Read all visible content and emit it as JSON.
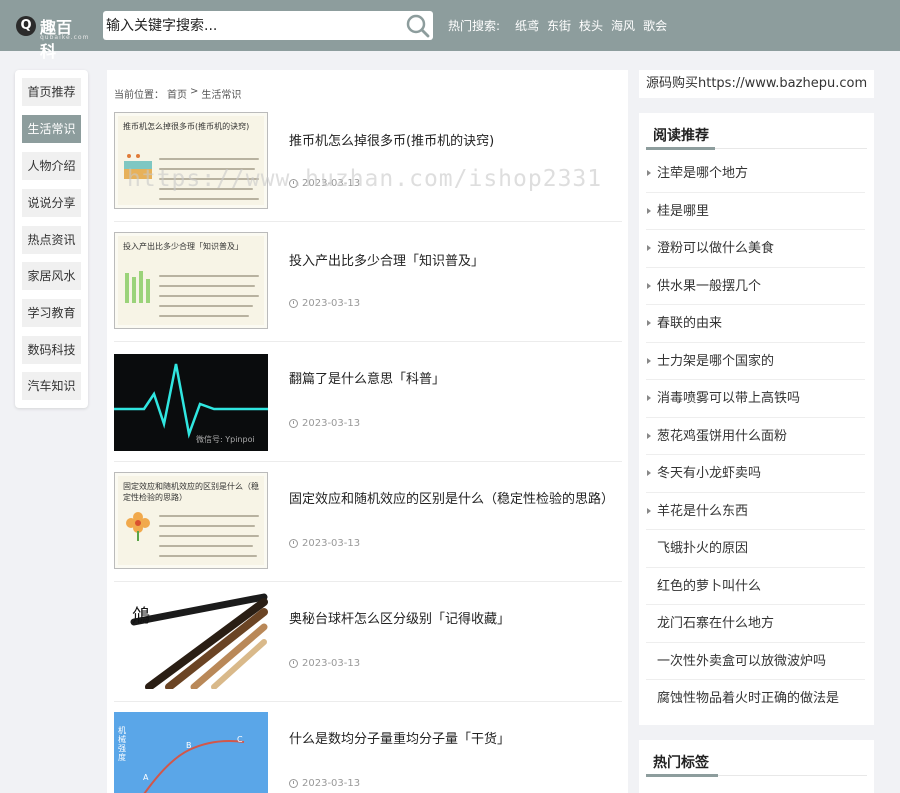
{
  "site": {
    "logo_text": "趣百科",
    "logo_sub": "qubaike.com"
  },
  "search": {
    "placeholder": "输入关键字搜索..."
  },
  "hot_search": {
    "label": "热门搜索:",
    "items": [
      "纸鸢",
      "东街",
      "枝头",
      "海风",
      "歌会"
    ]
  },
  "nav": {
    "items": [
      "首页推荐",
      "生活常识",
      "人物介绍",
      "说说分享",
      "热点资讯",
      "家居风水",
      "学习教育",
      "数码科技",
      "汽车知识"
    ],
    "active_index": 1
  },
  "breadcrumb": {
    "label": "当前位置：",
    "home": "首页",
    "sep": ">",
    "current": "生活常识"
  },
  "watermark": "https://www.huzhan.com/ishop2331",
  "articles": [
    {
      "title": "推币机怎么掉很多币(推币机的诀窍)",
      "date": "2023-03-13",
      "thumb_caption": "推币机怎么掉很多币(推币机的诀窍)",
      "thumb_icon": "coin-machine-icon"
    },
    {
      "title": "投入产出比多少合理「知识普及」",
      "date": "2023-03-13",
      "thumb_caption": "投入产出比多少合理「知识普及」",
      "thumb_icon": "bars-icon"
    },
    {
      "title": "翻篇了是什么意思「科普」",
      "date": "2023-03-13",
      "thumb_caption": "微信号: Ypinpoi",
      "thumb_icon": "heartbeat-icon"
    },
    {
      "title": "固定效应和随机效应的区别是什么（稳定性检验的思路）",
      "date": "2023-03-13",
      "thumb_caption": "固定效应和随机效应的区别是什么（稳定性检验的思路）",
      "thumb_icon": "flower-icon"
    },
    {
      "title": "奥秘台球杆怎么区分级别「记得收藏」",
      "date": "2023-03-13",
      "thumb_caption": "",
      "thumb_icon": "cue-stick-icon"
    },
    {
      "title": "什么是数均分子量重均分子量「干货」",
      "date": "2023-03-13",
      "thumb_caption": "机械强度",
      "thumb_icon": "curve-icon"
    }
  ],
  "ad": {
    "text": "源码购买https://www.bazhepu.com"
  },
  "recommend": {
    "title": "阅读推荐",
    "items": [
      {
        "label": "注荦是哪个地方",
        "arrow": true
      },
      {
        "label": "桂是哪里",
        "arrow": true
      },
      {
        "label": "澄粉可以做什么美食",
        "arrow": true
      },
      {
        "label": "供水果一般摆几个",
        "arrow": true
      },
      {
        "label": "春联的由来",
        "arrow": true
      },
      {
        "label": "士力架是哪个国家的",
        "arrow": true
      },
      {
        "label": "消毒喷雾可以带上高铁吗",
        "arrow": true
      },
      {
        "label": "葱花鸡蛋饼用什么面粉",
        "arrow": true
      },
      {
        "label": "冬天有小龙虾卖吗",
        "arrow": true
      },
      {
        "label": "羊花是什么东西",
        "arrow": true
      },
      {
        "label": "飞蛾扑火的原因",
        "arrow": false
      },
      {
        "label": "红色的萝卜叫什么",
        "arrow": false
      },
      {
        "label": "龙门石寨在什么地方",
        "arrow": false
      },
      {
        "label": "一次性外卖盒可以放微波炉吗",
        "arrow": false
      },
      {
        "label": "腐蚀性物品着火时正确的做法是",
        "arrow": false
      }
    ]
  },
  "tags": {
    "title": "热门标签"
  },
  "colors": {
    "header_bg": "#8d9d9d",
    "page_bg": "#f1f2f5",
    "accent": "#8d9d9d"
  }
}
